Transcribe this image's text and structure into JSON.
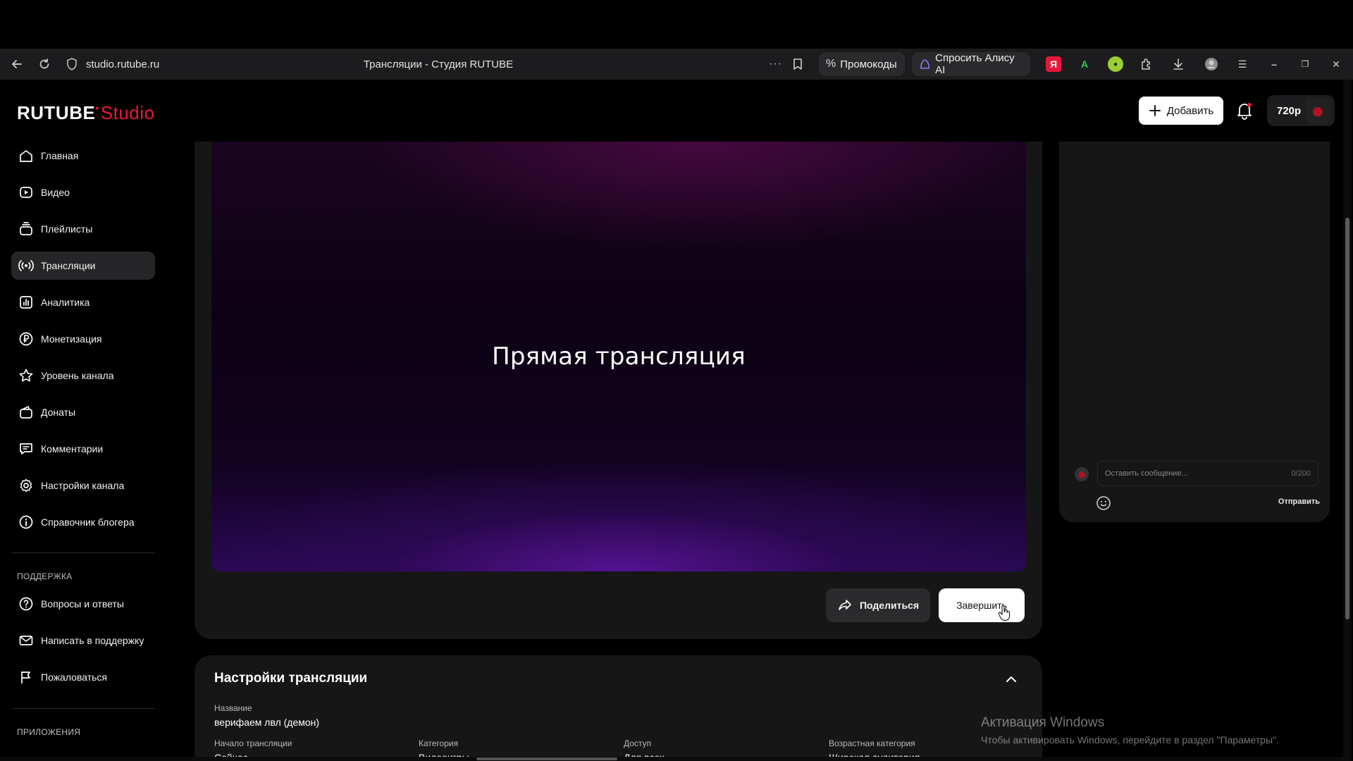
{
  "browser": {
    "url": "studio.rutube.ru",
    "tab_title": "Трансляции - Студия RUTUBE",
    "promo_label": "Промокоды",
    "alice_label": "Спросить Алису AI"
  },
  "header": {
    "logo_main": "RUTUBE",
    "logo_studio": "Studio",
    "add_label": "Добавить",
    "quality": "720p"
  },
  "sidebar": {
    "items": [
      {
        "label": "Главная",
        "icon": "home-icon"
      },
      {
        "label": "Видео",
        "icon": "video-icon"
      },
      {
        "label": "Плейлисты",
        "icon": "playlist-icon"
      },
      {
        "label": "Трансляции",
        "icon": "broadcast-icon",
        "active": true
      },
      {
        "label": "Аналитика",
        "icon": "analytics-icon"
      },
      {
        "label": "Монетизация",
        "icon": "ruble-icon"
      },
      {
        "label": "Уровень канала",
        "icon": "star-icon"
      },
      {
        "label": "Донаты",
        "icon": "wallet-icon"
      },
      {
        "label": "Комментарии",
        "icon": "comment-icon"
      },
      {
        "label": "Настройки канала",
        "icon": "gear-icon"
      },
      {
        "label": "Справочник блогера",
        "icon": "info-icon"
      }
    ],
    "support_label": "ПОДДЕРЖКА",
    "support_items": [
      {
        "label": "Вопросы и ответы",
        "icon": "question-icon"
      },
      {
        "label": "Написать в поддержку",
        "icon": "mail-icon"
      },
      {
        "label": "Пожаловаться",
        "icon": "flag-icon"
      }
    ],
    "apps_label": "ПРИЛОЖЕНИЯ"
  },
  "player": {
    "title": "Прямая трансляция",
    "share_label": "Поделиться",
    "finish_label": "Завершить"
  },
  "chat": {
    "placeholder": "Оставить сообщение...",
    "counter": "0/200",
    "send_label": "Отправить"
  },
  "settings": {
    "title": "Настройки трансляции",
    "name_label": "Название",
    "name_value": "верифаем лвл (демон)",
    "start_label": "Начало трансляции",
    "start_value": "Сейчас",
    "category_label": "Категория",
    "category_value": "Видеоигры",
    "access_label": "Доступ",
    "access_value": "Для всех",
    "age_label": "Возрастная категория",
    "age_value": "Широкая аудитория"
  },
  "watermark": {
    "title": "Активация Windows",
    "subtitle": "Чтобы активировать Windows, перейдите в раздел \"Параметры\"."
  },
  "colors": {
    "brand_red": "#ed143b",
    "bg": "#000000",
    "card": "#161617",
    "active_nav": "#262628"
  }
}
